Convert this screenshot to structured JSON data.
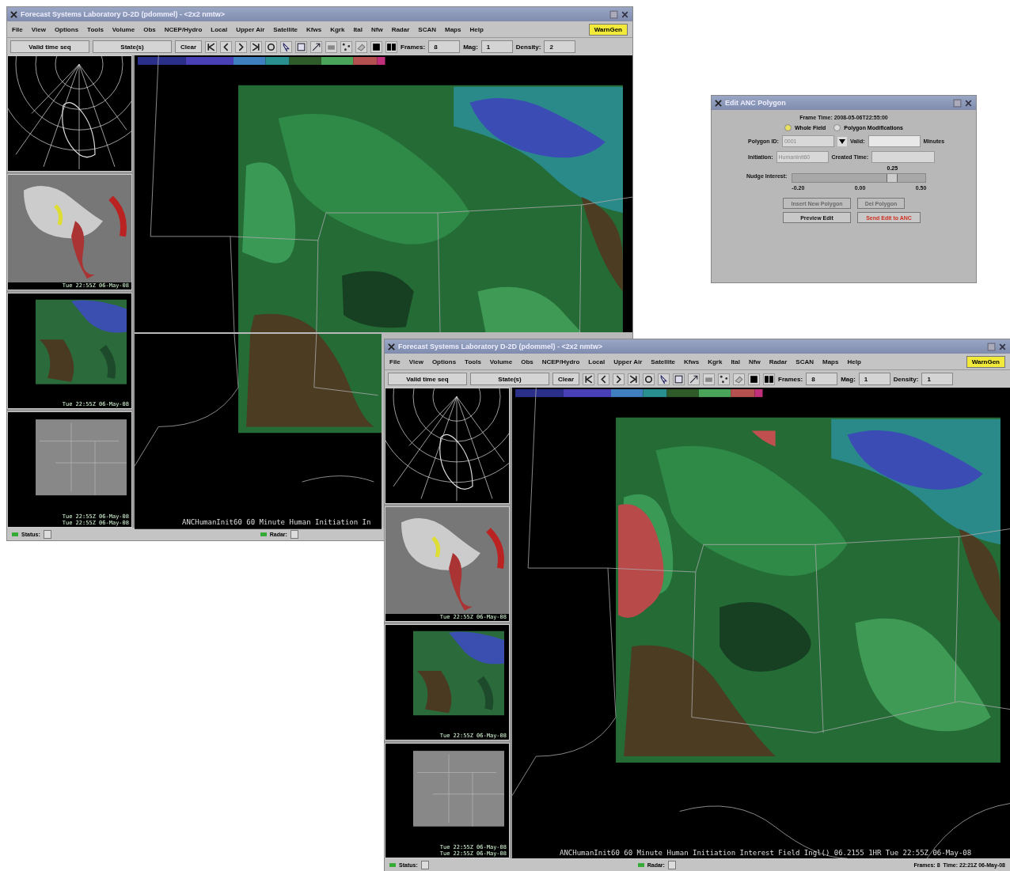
{
  "windows": [
    {
      "title": "Forecast Systems Laboratory D-2D (pdommel) - <2x2 nmtw>",
      "menus": [
        "File",
        "View",
        "Options",
        "Tools",
        "Volume",
        "Obs",
        "NCEP/Hydro",
        "Local",
        "Upper Air",
        "Satellite",
        "Kfws",
        "Kgrk",
        "Ital",
        "Nfw",
        "Radar",
        "SCAN",
        "Maps",
        "Help"
      ],
      "warngen": "WarnGen",
      "toolbar": {
        "time_mode": "Valid time seq",
        "state": "State(s)",
        "clear": "Clear",
        "frames_label": "Frames:",
        "frames": "8",
        "mag_label": "Mag:",
        "mag": "1",
        "density_label": "Density:",
        "density": "2"
      },
      "thumbnails": [
        {
          "kind": "polar"
        },
        {
          "kind": "satellite",
          "labels": [
            "Tue 22:55Z 06-May-08"
          ]
        },
        {
          "kind": "field",
          "labels": [
            "Tue 22:55Z 06-May-08"
          ]
        },
        {
          "kind": "gray",
          "labels": [
            "Tue 22:55Z 06-May-08",
            "Tue 22:55Z 06-May-08"
          ]
        }
      ],
      "caption": "ANCHumanInit60 60 Minute Human Initiation In",
      "status": [
        "Status:",
        "Radar:"
      ]
    },
    {
      "title": "Forecast Systems Laboratory D-2D (pdommel) - <2x2 nmtw>",
      "menus": [
        "File",
        "View",
        "Options",
        "Tools",
        "Volume",
        "Obs",
        "NCEP/Hydro",
        "Local",
        "Upper Air",
        "Satellite",
        "Kfws",
        "Kgrk",
        "Ital",
        "Nfw",
        "Radar",
        "SCAN",
        "Maps",
        "Help"
      ],
      "warngen": "WarnGen",
      "toolbar": {
        "time_mode": "Valid time seq",
        "state": "State(s)",
        "clear": "Clear",
        "frames_label": "Frames:",
        "frames": "8",
        "mag_label": "Mag:",
        "mag": "1",
        "density_label": "Density:",
        "density": "1"
      },
      "thumbnails": [
        {
          "kind": "polar"
        },
        {
          "kind": "satellite",
          "labels": [
            "Tue 22:55Z 06-May-08"
          ]
        },
        {
          "kind": "field",
          "labels": [
            "Tue 22:55Z 06-May-08"
          ]
        },
        {
          "kind": "gray",
          "labels": [
            "Tue 22:55Z 06-May-08",
            "Tue 22:55Z 06-May-08"
          ]
        }
      ],
      "caption": "ANCHumanInit60 60 Minute Human Initiation Interest Field Ingl() 06.2155   1HR Tue 22:55Z 06-May-08",
      "status": [
        "Status:",
        "Radar:"
      ],
      "status_right": [
        "Frames: 8",
        "Time: 22:21Z 06-May-08"
      ]
    }
  ],
  "dialog": {
    "title": "Edit ANC Polygon",
    "frame_time": "Frame Time: 2008-05-06T22:55:00",
    "modes": [
      {
        "label": "Whole Field",
        "selected": true
      },
      {
        "label": "Polygon Modifications",
        "selected": false
      }
    ],
    "polygon_id_label": "Polygon ID:",
    "polygon_id": "0001",
    "valid_label": "Valid:",
    "minutes_label": "Minutes",
    "initiation_label": "Initiation:",
    "initiation": "HumanInit60",
    "created_label": "Created Time:",
    "nudge_label": "Nudge Interest:",
    "nudge": {
      "reading": "0.25",
      "level": 0.75,
      "ticks": [
        "-0.20",
        "0.00",
        "0.50"
      ]
    },
    "buttons": [
      {
        "label": "Insert New Polygon",
        "disabled": true,
        "kind": "plain"
      },
      {
        "label": "Del Polygon",
        "disabled": true,
        "kind": "plain"
      },
      {
        "label": "Preview Edit",
        "disabled": false,
        "kind": "plain"
      },
      {
        "label": "Send Edit to ANC",
        "disabled": false,
        "kind": "send"
      }
    ]
  }
}
